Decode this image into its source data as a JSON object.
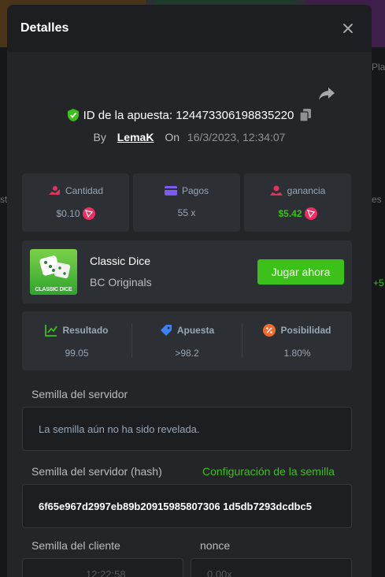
{
  "modal": {
    "title": "Detalles",
    "bet_id_label": "ID de la apuesta: 124473306198835220",
    "by_label": "By",
    "username": "LemaK",
    "on_label": "On",
    "date": "16/3/2023, 12:34:07"
  },
  "stats": [
    {
      "label": "Cantidad",
      "value": "$0.10",
      "icon": "money-hand-icon",
      "coin": true
    },
    {
      "label": "Pagos",
      "value": "55 x",
      "icon": "wallet-icon",
      "coin": false
    },
    {
      "label": "ganancia",
      "value": "$5.42",
      "icon": "profit-hand-icon",
      "coin": true
    }
  ],
  "game": {
    "name": "Classic Dice",
    "provider": "BC Originals",
    "thumb_text": "CLASSIC DICE",
    "play_label": "Jugar ahora"
  },
  "results": [
    {
      "label": "Resultado",
      "value": "99.05",
      "icon": "result-chart-icon"
    },
    {
      "label": "Apuesta",
      "value": ">98.2",
      "icon": "bet-tag-icon"
    },
    {
      "label": "Posibilidad",
      "value": "1.80%",
      "icon": "percent-icon"
    }
  ],
  "seeds": {
    "server_seed_label": "Semilla del servidor",
    "server_seed_value": "La semilla aún no ha sido revelada.",
    "server_hash_label": "Semilla del servidor (hash)",
    "seed_settings_link": "Configuración de la semilla",
    "server_hash_value": "6f65e967d2997eb89b20915985807306 1d5db7293dcdbc5",
    "client_seed_label": "Semilla del cliente",
    "nonce_label": "nonce",
    "client_seed_value": "12:22:58",
    "nonce_value": "0.00x"
  },
  "background": {
    "left_text": "st",
    "right_text_1": "Pla",
    "right_text_2": "es",
    "right_text_3": "+5"
  },
  "colors": {
    "accent_green": "#3bc117",
    "coin_red": "#ef2d5e",
    "modal_bg": "#232529",
    "card_bg": "#2c2f34"
  }
}
